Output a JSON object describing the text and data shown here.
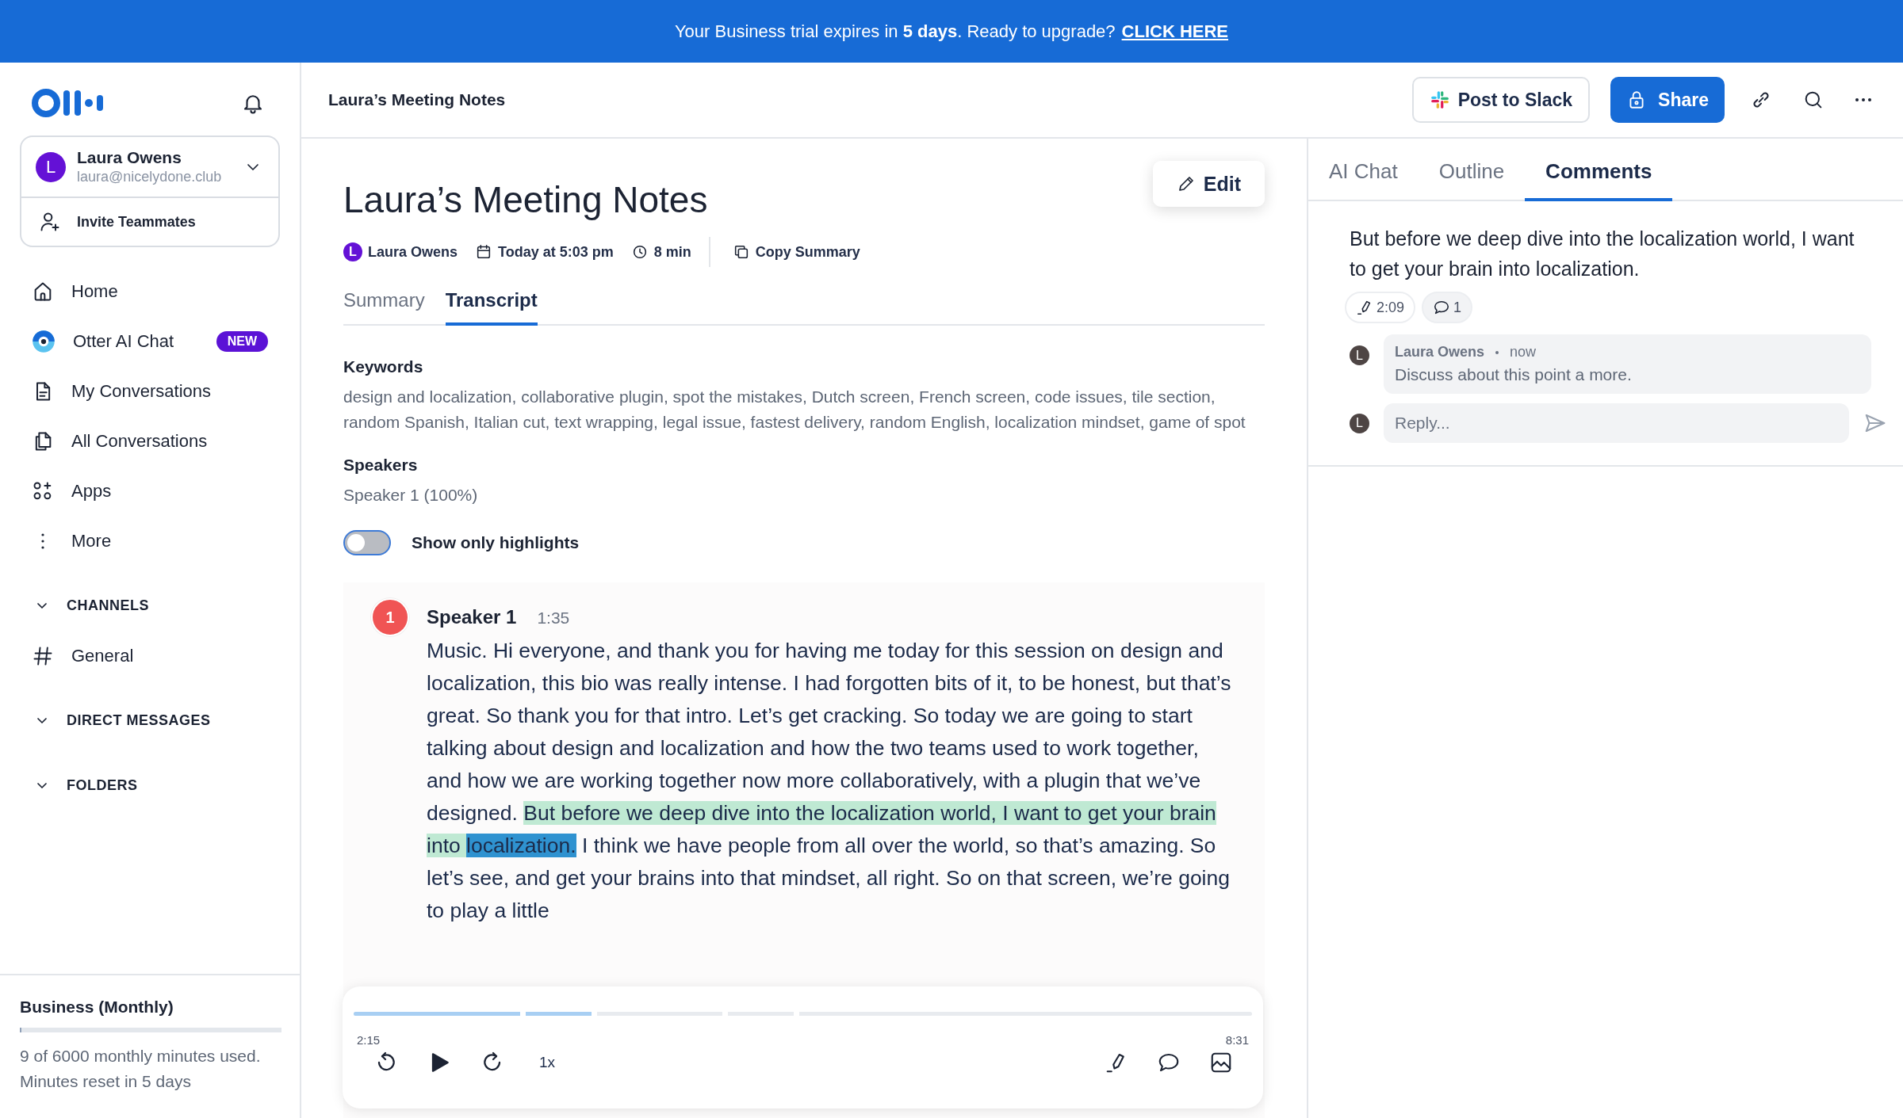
{
  "banner": {
    "text": "Your Business trial expires in **5 days**. Ready to upgrade?",
    "link": "CLICK HERE"
  },
  "sidebar": {
    "user": {
      "initial": "L",
      "name": "Laura Owens",
      "email": "laura@nicelydone.club"
    },
    "invite": "Invite Teammates",
    "items": [
      {
        "kind": "home",
        "label": "Home"
      },
      {
        "kind": "otter",
        "label": "Otter AI Chat",
        "badge": "NEW"
      },
      {
        "kind": "doc",
        "label": "My Conversations"
      },
      {
        "kind": "docs",
        "label": "All Conversations"
      },
      {
        "kind": "apps",
        "label": "Apps"
      },
      {
        "kind": "more",
        "label": "More"
      }
    ],
    "sections": [
      {
        "title": "CHANNELS",
        "expanded": true,
        "items": [
          {
            "label": "General"
          }
        ]
      },
      {
        "title": "DIRECT MESSAGES",
        "expanded": true
      },
      {
        "title": "FOLDERS",
        "expanded": true
      }
    ],
    "plan": {
      "name": "Business (Monthly)",
      "level": 0.002,
      "usage": "9 of 6000 monthly minutes used. Minutes reset in 5 days"
    }
  },
  "header": {
    "title": "Laura’s Meeting Notes",
    "slack": "Post to Slack",
    "share": "Share"
  },
  "note": {
    "title": "Laura’s Meeting Notes",
    "edit": "Edit",
    "author_initial": "L",
    "author": "Laura Owens",
    "date": "Today at 5:03 pm",
    "duration": "8 min",
    "copy": "Copy Summary",
    "tabs": [
      {
        "label": "Summary",
        "selected": false
      },
      {
        "label": "Transcript",
        "selected": true
      }
    ],
    "keywords_title": "Keywords",
    "keywords": "design and localization, collaborative plugin, spot the mistakes, Dutch screen, French screen, code issues, tile section, random Spanish, Italian cut, text wrapping, legal issue, fastest delivery, random English, localization mindset, game of spot",
    "speakers_title": "Speakers",
    "speakers": "Speaker 1 (100%)",
    "highlights_toggle": {
      "label": "Show only highlights",
      "on": false
    },
    "transcript": {
      "avatar": "1",
      "speaker": "Speaker 1",
      "time": "1:35",
      "segments": [
        {
          "kind": "plain",
          "text": "Music. Hi everyone, and thank you for having me today for this session on design  and localization, this bio was really intense. I had forgotten bits of it, to be honest, but that’s great. So thank you for that intro. Let’s get cracking. So today we are going to start talking about design and localization and how the two teams used to work together, and how we are working together now more collaboratively, with a plugin that we’ve designed. "
        },
        {
          "kind": "highlight",
          "text": "But before we deep dive into the localization world, I want to get your brain into "
        },
        {
          "kind": "current",
          "text": "localization."
        },
        {
          "kind": "plain",
          "text": " I think we have people from all over the world, so that’s amazing. So let’s see, and get your brains into that mindset, all right. So on that screen, we’re going to play a little"
        }
      ]
    },
    "player": {
      "elapsed": "2:15",
      "total": "8:31",
      "level": 0.27,
      "speed": "1x"
    }
  },
  "panel": {
    "tabs": [
      {
        "label": "AI Chat",
        "selected": false
      },
      {
        "label": "Outline",
        "selected": false
      },
      {
        "label": "Comments",
        "selected": true
      }
    ],
    "quote": "But before we deep dive into the localization world, I want to get your brain into localization.",
    "chips": {
      "time": "2:09",
      "count": "1"
    },
    "comments": [
      {
        "initial": "L",
        "author": "Laura Owens",
        "when": "now",
        "text": "Discuss about this point a more."
      }
    ],
    "reply": {
      "initial": "L",
      "placeholder": "Reply..."
    }
  }
}
